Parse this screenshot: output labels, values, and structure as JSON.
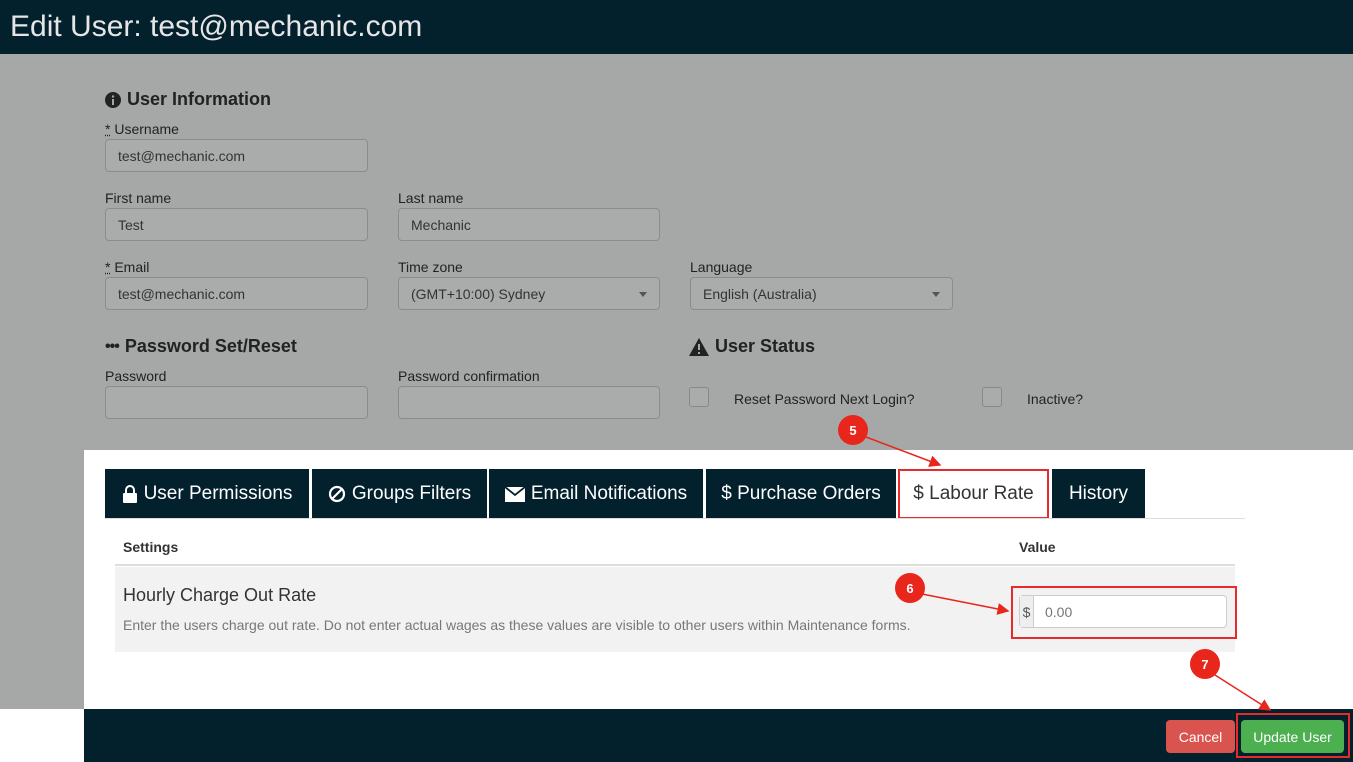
{
  "header": {
    "title": "Edit User: test@mechanic.com"
  },
  "user_info": {
    "section_title": "User Information",
    "username_label": "Username",
    "username_value": "test@mechanic.com",
    "first_name_label": "First name",
    "first_name_value": "Test",
    "last_name_label": "Last name",
    "last_name_value": "Mechanic",
    "email_label": "Email",
    "email_value": "test@mechanic.com",
    "timezone_label": "Time zone",
    "timezone_value": "(GMT+10:00) Sydney",
    "language_label": "Language",
    "language_value": "English (Australia)",
    "required_mark": "*"
  },
  "password": {
    "section_title": "Password Set/Reset",
    "password_label": "Password",
    "confirm_label": "Password confirmation",
    "icon": "ellipsis-icon"
  },
  "user_status": {
    "section_title": "User Status",
    "reset_label": "Reset Password Next Login?",
    "inactive_label": "Inactive?",
    "icon": "warning-icon"
  },
  "tabs": [
    {
      "label": "User Permissions",
      "icon": "lock-icon"
    },
    {
      "label": "Groups Filters",
      "icon": "ban-icon"
    },
    {
      "label": "Email Notifications",
      "icon": "envelope-icon"
    },
    {
      "label": "$ Purchase Orders"
    },
    {
      "label": "$ Labour Rate"
    },
    {
      "label": "History"
    }
  ],
  "table": {
    "col_settings": "Settings",
    "col_value": "Value",
    "row_title": "Hourly Charge Out Rate",
    "row_desc": "Enter the users charge out rate. Do not enter actual wages as these values are visible to other users within Maintenance forms.",
    "currency": "$",
    "rate_placeholder": "0.00"
  },
  "footer": {
    "cancel": "Cancel",
    "update": "Update User"
  },
  "annotations": {
    "m5": "5",
    "m6": "6",
    "m7": "7"
  },
  "colors": {
    "header_bg": "#03202d",
    "annotation_red": "#e8261c",
    "update_green": "#4caf50",
    "cancel_red": "#d9534f"
  }
}
